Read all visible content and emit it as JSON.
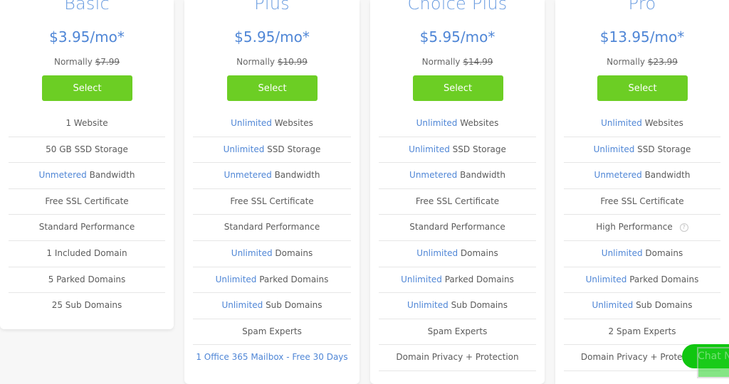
{
  "plans": [
    {
      "name": "Basic",
      "price": "$3.95/mo*",
      "normally_label": "Normally",
      "normal_price": "$7.99",
      "select_label": "Select",
      "features": [
        {
          "highlight": "",
          "text": "1 Website"
        },
        {
          "highlight": "",
          "text": "50 GB SSD Storage"
        },
        {
          "highlight": "Unmetered",
          "text": " Bandwidth"
        },
        {
          "highlight": "",
          "text": "Free SSL Certificate"
        },
        {
          "highlight": "",
          "text": "Standard Performance"
        },
        {
          "highlight": "",
          "text": "1 Included Domain"
        },
        {
          "highlight": "",
          "text": "5 Parked Domains"
        },
        {
          "highlight": "",
          "text": "25 Sub Domains"
        }
      ]
    },
    {
      "name": "Plus",
      "price": "$5.95/mo*",
      "normally_label": "Normally",
      "normal_price": "$10.99",
      "select_label": "Select",
      "features": [
        {
          "highlight": "Unlimited",
          "text": " Websites"
        },
        {
          "highlight": "Unlimited",
          "text": " SSD Storage"
        },
        {
          "highlight": "Unmetered",
          "text": " Bandwidth"
        },
        {
          "highlight": "",
          "text": "Free SSL Certificate"
        },
        {
          "highlight": "",
          "text": "Standard Performance"
        },
        {
          "highlight": "Unlimited",
          "text": " Domains"
        },
        {
          "highlight": "Unlimited",
          "text": " Parked Domains"
        },
        {
          "highlight": "Unlimited",
          "text": " Sub Domains"
        },
        {
          "highlight": "",
          "text": "Spam Experts"
        }
      ],
      "extra_link": "1 Office 365 Mailbox - Free 30 Days"
    },
    {
      "name": "Choice Plus",
      "price": "$5.95/mo*",
      "normally_label": "Normally",
      "normal_price": "$14.99",
      "select_label": "Select",
      "features": [
        {
          "highlight": "Unlimited",
          "text": " Websites"
        },
        {
          "highlight": "Unlimited",
          "text": " SSD Storage"
        },
        {
          "highlight": "Unmetered",
          "text": " Bandwidth"
        },
        {
          "highlight": "",
          "text": "Free SSL Certificate"
        },
        {
          "highlight": "",
          "text": "Standard Performance"
        },
        {
          "highlight": "Unlimited",
          "text": " Domains"
        },
        {
          "highlight": "Unlimited",
          "text": " Parked Domains"
        },
        {
          "highlight": "Unlimited",
          "text": " Sub Domains"
        },
        {
          "highlight": "",
          "text": "Spam Experts"
        },
        {
          "highlight": "",
          "text": "Domain Privacy + Protection"
        }
      ]
    },
    {
      "name": "Pro",
      "price": "$13.95/mo*",
      "normally_label": "Normally",
      "normal_price": "$23.99",
      "select_label": "Select",
      "features": [
        {
          "highlight": "Unlimited",
          "text": " Websites"
        },
        {
          "highlight": "Unlimited",
          "text": " SSD Storage"
        },
        {
          "highlight": "Unmetered",
          "text": " Bandwidth"
        },
        {
          "highlight": "",
          "text": "Free SSL Certificate"
        },
        {
          "highlight": "",
          "text": "High Performance",
          "help": "?"
        },
        {
          "highlight": "Unlimited",
          "text": " Domains"
        },
        {
          "highlight": "Unlimited",
          "text": " Parked Domains"
        },
        {
          "highlight": "Unlimited",
          "text": " Sub Domains"
        },
        {
          "highlight": "",
          "text": "2 Spam Experts"
        },
        {
          "highlight": "",
          "text": "Domain Privacy + Protection"
        }
      ]
    }
  ],
  "chat": {
    "label": "Chat Now"
  },
  "colors": {
    "accent_blue": "#4f86d6",
    "button_green": "#6cce24",
    "chat_green": "#10c610"
  }
}
